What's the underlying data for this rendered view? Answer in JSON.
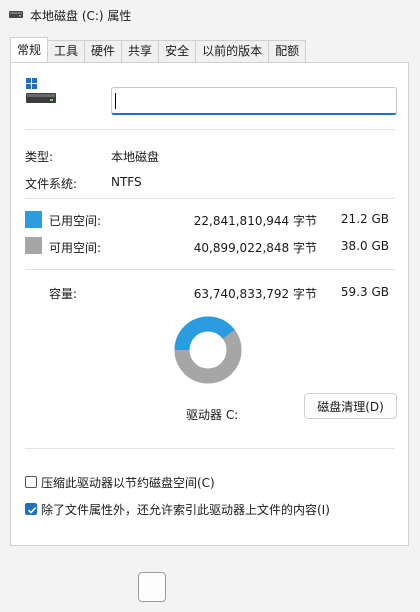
{
  "window": {
    "title": "本地磁盘 (C:) 属性"
  },
  "tabs": [
    {
      "label": "常规",
      "active": true
    },
    {
      "label": "工具"
    },
    {
      "label": "硬件"
    },
    {
      "label": "共享"
    },
    {
      "label": "安全"
    },
    {
      "label": "以前的版本"
    },
    {
      "label": "配额"
    }
  ],
  "general": {
    "name_input": {
      "value": ""
    },
    "type": {
      "label": "类型:",
      "value": "本地磁盘"
    },
    "filesystem": {
      "label": "文件系统:",
      "value": "NTFS"
    },
    "used": {
      "label": "已用空间:",
      "bytes": "22,841,810,944 字节",
      "size": "21.2 GB",
      "color": "#2b9ce0"
    },
    "free": {
      "label": "可用空间:",
      "bytes": "40,899,022,848 字节",
      "size": "38.0 GB",
      "color": "#a6a6a6"
    },
    "capacity": {
      "label": "容量:",
      "bytes": "63,740,833,792 字节",
      "size": "59.3 GB"
    },
    "drive_label": "驱动器 C:",
    "cleanup_button": "磁盘清理(D)",
    "compress_checkbox": {
      "label": "压缩此驱动器以节约磁盘空间(C)",
      "checked": false
    },
    "index_checkbox": {
      "label": "除了文件属性外，还允许索引此驱动器上文件的内容(I)",
      "checked": true
    }
  }
}
